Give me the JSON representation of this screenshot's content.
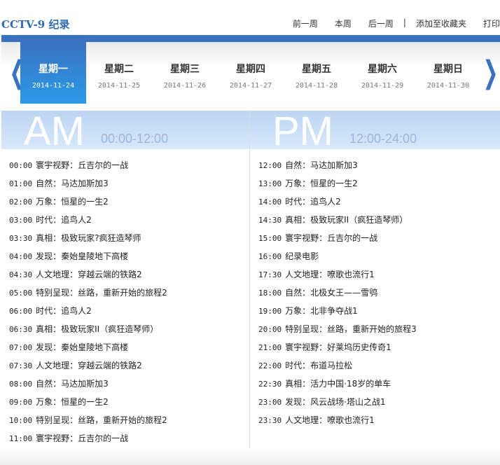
{
  "header": {
    "title": "CCTV-9 纪录",
    "links": [
      "前一周",
      "本周",
      "后一周",
      "|",
      "添加至收藏夹",
      "打印"
    ]
  },
  "tabs": [
    {
      "name": "星期一",
      "date": "2014-11-24",
      "active": true
    },
    {
      "name": "星期二",
      "date": "2014-11-25"
    },
    {
      "name": "星期三",
      "date": "2014-11-26"
    },
    {
      "name": "星期四",
      "date": "2014-11-27"
    },
    {
      "name": "星期五",
      "date": "2014-11-28"
    },
    {
      "name": "星期六",
      "date": "2014-11-29"
    },
    {
      "name": "星期日",
      "date": "2014-11-30"
    }
  ],
  "am": {
    "label": "AM",
    "range": "00:00-12:00",
    "items": [
      [
        "00:00",
        "寰宇视野：丘吉尔的一战"
      ],
      [
        "01:00",
        "自然：马达加斯加3"
      ],
      [
        "02:00",
        "万象：恒星的一生2"
      ],
      [
        "03:00",
        "时代：追鸟人2"
      ],
      [
        "03:30",
        "真相：极致玩家?疯狂造琴师"
      ],
      [
        "04:00",
        "发现：秦始皇陵地下高楼"
      ],
      [
        "04:30",
        "人文地理：穿越云端的铁路2"
      ],
      [
        "05:00",
        "特别呈现：丝路，重新开始的旅程2"
      ],
      [
        "06:00",
        "时代：追鸟人2"
      ],
      [
        "06:30",
        "真相：极致玩家II（疯狂造琴师）"
      ],
      [
        "07:00",
        "发现：秦始皇陵地下高楼"
      ],
      [
        "07:30",
        "人文地理：穿越云端的铁路2"
      ],
      [
        "08:00",
        "自然：马达加斯加3"
      ],
      [
        "09:00",
        "万象：恒星的一生2"
      ],
      [
        "10:00",
        "特别呈现：丝路，重新开始的旅程2"
      ],
      [
        "11:00",
        "寰宇视野：丘吉尔的一战"
      ]
    ]
  },
  "pm": {
    "label": "PM",
    "range": "12:00-24:00",
    "items": [
      [
        "12:00",
        "自然：马达加斯加3"
      ],
      [
        "13:00",
        "万象：恒星的一生2"
      ],
      [
        "14:00",
        "时代：追鸟人2"
      ],
      [
        "14:30",
        "真相：极致玩家II（疯狂造琴师）"
      ],
      [
        "15:00",
        "寰宇视野：丘吉尔的一战"
      ],
      [
        "16:00",
        "纪录电影"
      ],
      [
        "17:30",
        "人文地理：嘹歌也流行1"
      ],
      [
        "18:00",
        "自然：北极女王——雪鸮"
      ],
      [
        "19:00",
        "万象：北非争夺战1"
      ],
      [
        "20:00",
        "特别呈现：丝路，重新开始的旅程3"
      ],
      [
        "21:00",
        "寰宇视野：好莱坞历史传奇1"
      ],
      [
        "22:00",
        "时代：布道马拉松"
      ],
      [
        "22:30",
        "真相：活力中国·18岁的单车"
      ],
      [
        "23:00",
        "发现：风云战场·塔山之战1"
      ],
      [
        "23:30",
        "人文地理：嘹歌也流行1"
      ]
    ]
  }
}
